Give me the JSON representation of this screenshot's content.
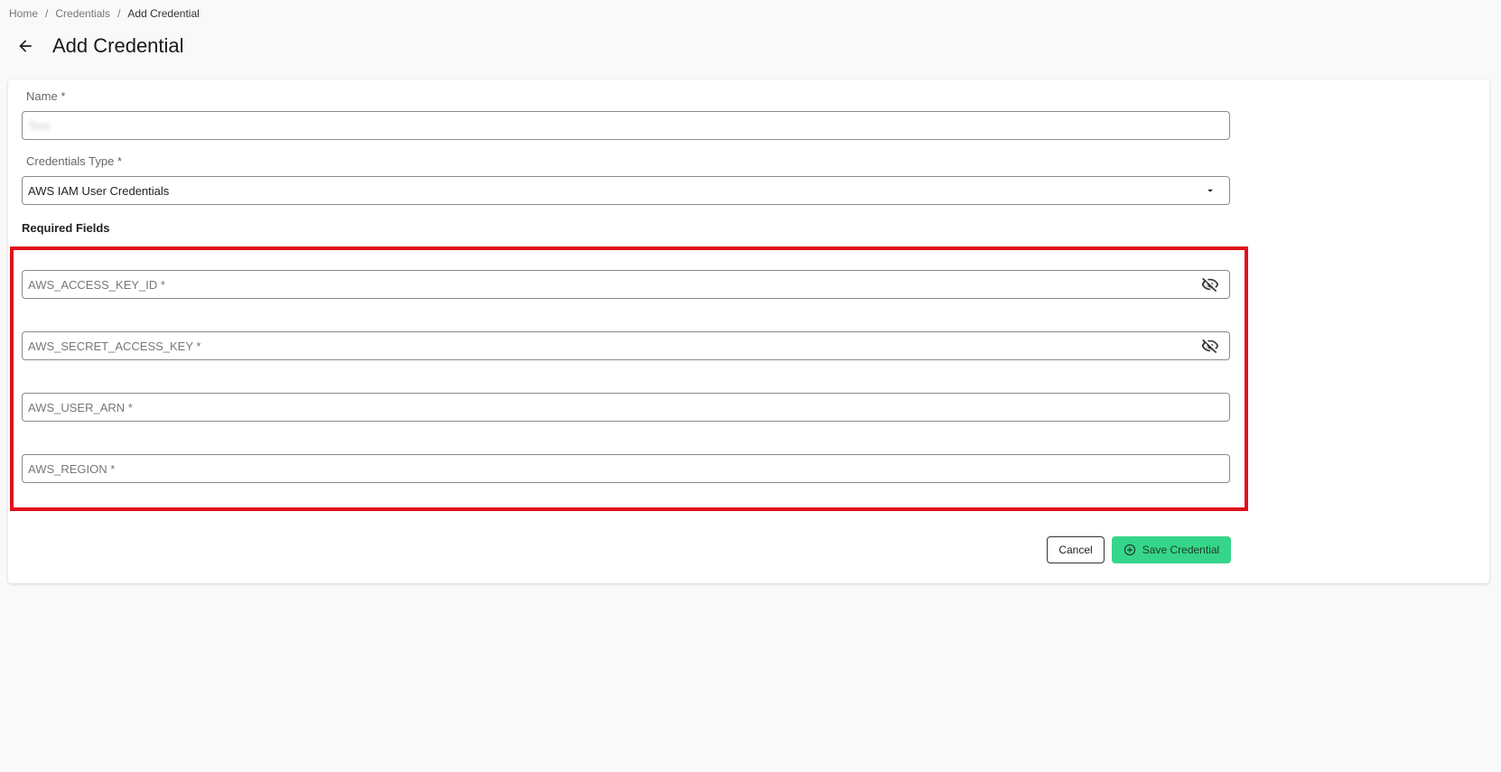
{
  "breadcrumb": {
    "items": [
      "Home",
      "Credentials",
      "Add Credential"
    ],
    "separator": "/"
  },
  "header": {
    "title": "Add Credential",
    "back_icon": "arrow-left-icon"
  },
  "form": {
    "name": {
      "label": "Name",
      "required_mark": "*",
      "value": "Test"
    },
    "credentials_type": {
      "label": "Credentials Type",
      "required_mark": "*",
      "value": "AWS IAM User Credentials",
      "dropdown_icon": "caret-down-icon"
    },
    "required_section_title": "Required Fields",
    "required_fields": [
      {
        "placeholder": "AWS_ACCESS_KEY_ID *",
        "icon": "eye-off-icon"
      },
      {
        "placeholder": "AWS_SECRET_ACCESS_KEY *",
        "icon": "eye-off-icon"
      },
      {
        "placeholder": "AWS_USER_ARN *"
      },
      {
        "placeholder": "AWS_REGION *"
      }
    ]
  },
  "actions": {
    "cancel_label": "Cancel",
    "save_label": "Save Credential",
    "save_icon": "plus-circle-icon"
  },
  "colors": {
    "accent": "#35d68a",
    "highlight": "#e0101a",
    "background": "#f9f9f9"
  }
}
